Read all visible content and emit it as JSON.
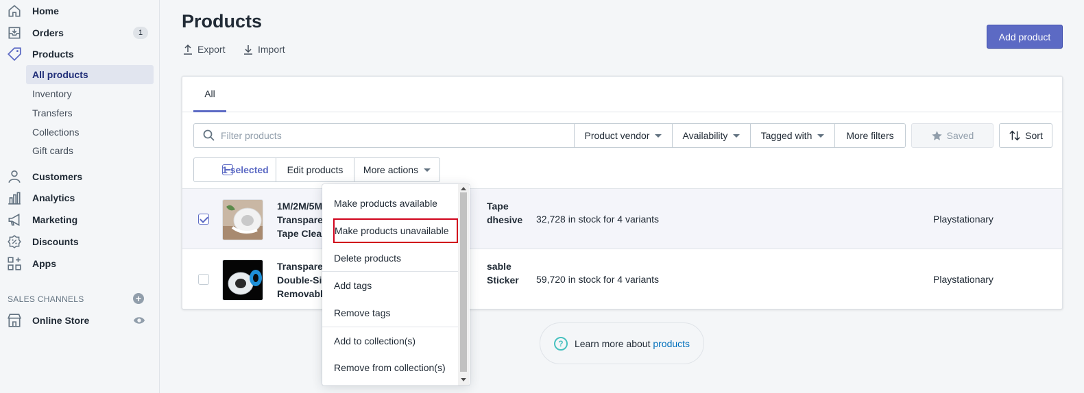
{
  "sidebar": {
    "items": [
      {
        "label": "Home",
        "icon": "home-icon"
      },
      {
        "label": "Orders",
        "icon": "orders-icon",
        "badge": "1"
      },
      {
        "label": "Products",
        "icon": "tag-icon"
      }
    ],
    "product_sub": [
      {
        "label": "All products",
        "active": true
      },
      {
        "label": "Inventory"
      },
      {
        "label": "Transfers"
      },
      {
        "label": "Collections"
      },
      {
        "label": "Gift cards"
      }
    ],
    "lower_items": [
      {
        "label": "Customers",
        "icon": "person-icon"
      },
      {
        "label": "Analytics",
        "icon": "analytics-icon"
      },
      {
        "label": "Marketing",
        "icon": "megaphone-icon"
      },
      {
        "label": "Discounts",
        "icon": "discount-icon"
      },
      {
        "label": "Apps",
        "icon": "apps-icon"
      }
    ],
    "sales_channels_label": "SALES CHANNELS",
    "online_store": "Online Store"
  },
  "header": {
    "title": "Products",
    "export": "Export",
    "import": "Import",
    "add_product": "Add product"
  },
  "tabs": [
    "All"
  ],
  "filters": {
    "placeholder": "Filter products",
    "buttons": [
      "Product vendor",
      "Availability",
      "Tagged with",
      "More filters"
    ],
    "saved": "Saved",
    "sort": "Sort"
  },
  "bulk": {
    "selected": "1 selected",
    "edit": "Edit products",
    "more": "More actions"
  },
  "products": [
    {
      "name_lines": [
        "1M/2M/5M",
        "Transparen",
        "Tape Clean"
      ],
      "name_tail": [
        "Tape",
        "dhesive",
        ""
      ],
      "stock": "32,728 in stock for 4 variants",
      "vendor": "Playstationary",
      "checked": true
    },
    {
      "name_lines": [
        "Transparen",
        "Double-Sic",
        "Removable"
      ],
      "name_tail": [
        "sable",
        "Sticker",
        ""
      ],
      "stock": "59,720 in stock for 4 variants",
      "vendor": "Playstationary",
      "checked": false
    }
  ],
  "dropdown": {
    "items": [
      "Make products available",
      "Make products unavailable",
      "Delete products",
      "Add tags",
      "Remove tags",
      "Add to collection(s)",
      "Remove from collection(s)"
    ]
  },
  "learn_more": {
    "text": "Learn more about ",
    "link": "products"
  }
}
